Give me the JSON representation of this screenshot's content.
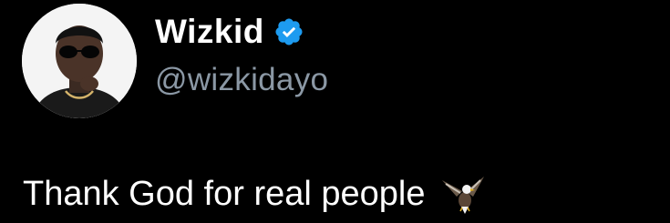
{
  "tweet": {
    "author": {
      "display_name": "Wizkid",
      "handle": "@wizkidayo",
      "verified": true,
      "verified_color": "#1d9bf0",
      "avatar_icon": "profile-photo"
    },
    "text": "Thank God for real people",
    "emoji": "eagle-icon"
  },
  "colors": {
    "background": "#000000",
    "text": "#ffffff",
    "handle": "#8b98a5"
  }
}
